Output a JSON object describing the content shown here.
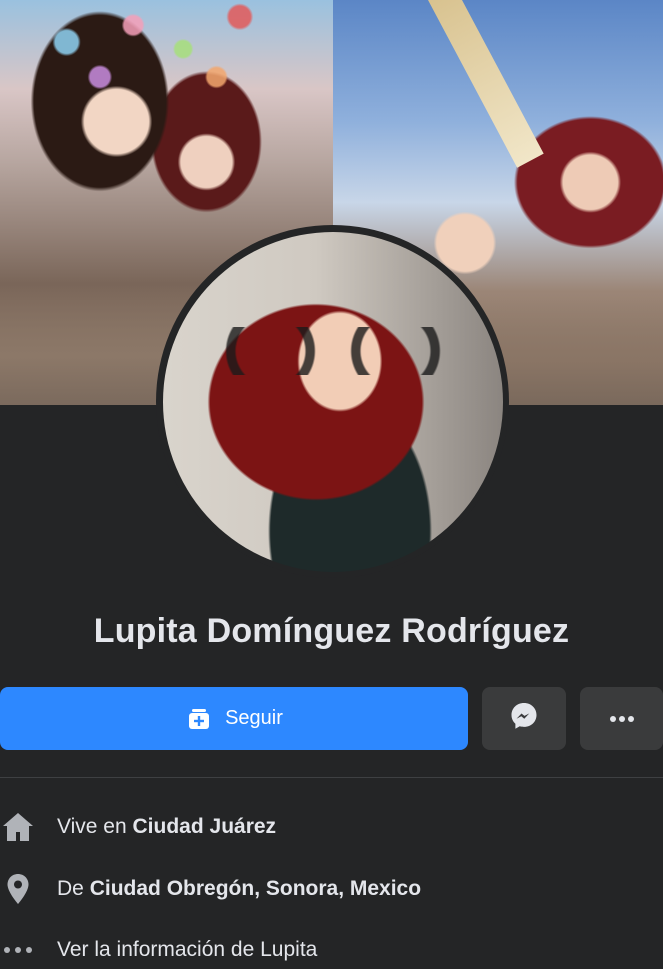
{
  "profile": {
    "name": "Lupita Domínguez Rodríguez"
  },
  "actions": {
    "follow_label": "Seguir",
    "messenger_icon": "messenger-icon",
    "more_icon": "more-horizontal-icon"
  },
  "info": {
    "lives_prefix": "Vive en",
    "lives_city": "Ciudad Juárez",
    "from_prefix": "De",
    "from_place": "Ciudad Obregón, Sonora, Mexico",
    "see_info": "Ver la información de Lupita"
  },
  "colors": {
    "background": "#242526",
    "primary_button": "#2d88ff",
    "secondary_button": "#3a3b3c",
    "text": "#e4e6eb"
  }
}
